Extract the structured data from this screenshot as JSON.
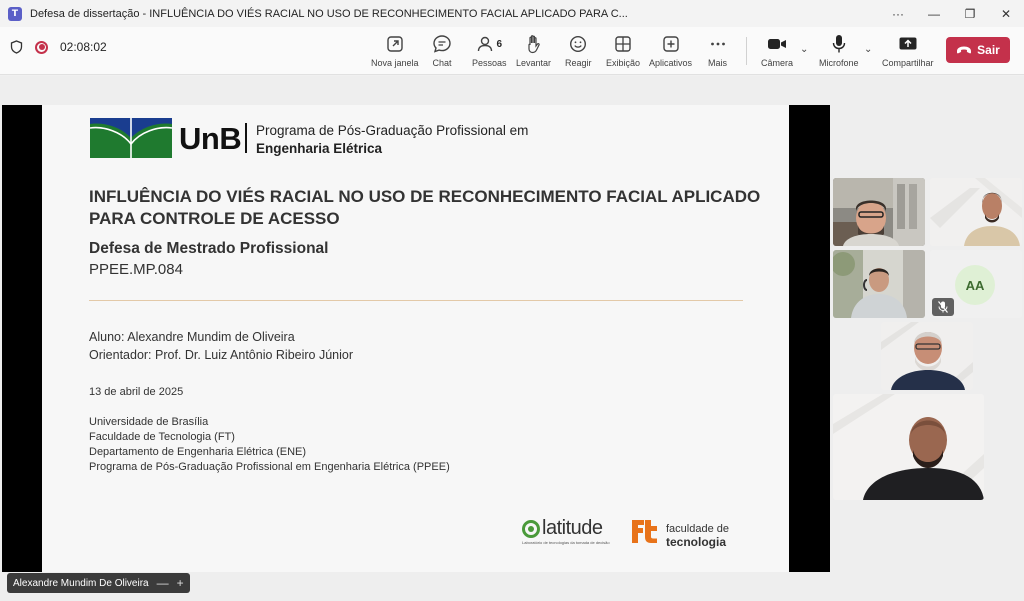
{
  "window": {
    "title": "Defesa de dissertação - INFLUÊNCIA DO VIÉS RACIAL NO USO DE RECONHECIMENTO FACIAL APLICADO PARA C...",
    "more_glyph": "···",
    "minimize_glyph": "—",
    "maximize_glyph": "❐",
    "close_glyph": "✕"
  },
  "toolbar": {
    "timer": "02:08:02",
    "new_window_label": "Nova janela",
    "chat_label": "Chat",
    "people_label": "Pessoas",
    "people_count": "6",
    "raise_hand_label": "Levantar",
    "react_label": "Reagir",
    "view_label": "Exibição",
    "apps_label": "Aplicativos",
    "more_label": "Mais",
    "camera_label": "Câmera",
    "mic_label": "Microfone",
    "share_label": "Compartilhar",
    "leave_label": "Sair",
    "chevron_glyph": "⌄"
  },
  "slide": {
    "program_line1": "Programa de Pós-Graduação Profissional em",
    "program_line2": "Engenharia Elétrica",
    "unb_logo_text": "UnB",
    "title": "INFLUÊNCIA DO VIÉS RACIAL NO USO DE RECONHECIMENTO FACIAL APLICADO PARA CONTROLE DE ACESSO",
    "subtitle": "Defesa de Mestrado Profissional",
    "code": "PPEE.MP.084",
    "student": "Aluno: Alexandre Mundim de Oliveira",
    "advisor": "Orientador: Prof. Dr. Luiz Antônio Ribeiro Júnior",
    "date": "13 de abril de 2025",
    "institution_lines": [
      "Universidade de Brasília",
      "Faculdade de Tecnologia (FT)",
      "Departamento de Engenharia Elétrica (ENE)",
      "Programa de Pós-Graduação Profissional em Engenharia Elétrica (PPEE)"
    ],
    "latitude_logo_text": "latitude",
    "latitude_tagline": "Laboratório de tecnologias da tomada de decisão",
    "ft_line1": "faculdade de",
    "ft_line2": "tecnologia"
  },
  "participants": {
    "initials_tile": "AA",
    "presenter_name": "Alexandre Mundim De Oliveira",
    "presenter_minus": "—",
    "presenter_plus": "+"
  },
  "colors": {
    "leave": "#c4314b",
    "unb_green": "#1f7a2f",
    "unb_blue": "#1a3d8f",
    "ft_orange": "#e8731a"
  }
}
